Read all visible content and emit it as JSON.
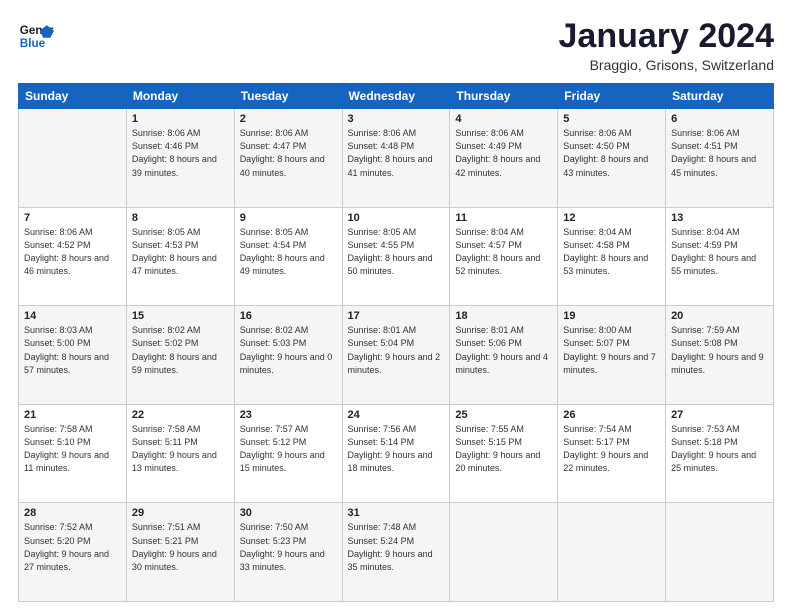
{
  "logo": {
    "line1": "General",
    "line2": "Blue"
  },
  "title": "January 2024",
  "location": "Braggio, Grisons, Switzerland",
  "days_header": [
    "Sunday",
    "Monday",
    "Tuesday",
    "Wednesday",
    "Thursday",
    "Friday",
    "Saturday"
  ],
  "weeks": [
    [
      {
        "day": "",
        "sunrise": "",
        "sunset": "",
        "daylight": ""
      },
      {
        "day": "1",
        "sunrise": "Sunrise: 8:06 AM",
        "sunset": "Sunset: 4:46 PM",
        "daylight": "Daylight: 8 hours and 39 minutes."
      },
      {
        "day": "2",
        "sunrise": "Sunrise: 8:06 AM",
        "sunset": "Sunset: 4:47 PM",
        "daylight": "Daylight: 8 hours and 40 minutes."
      },
      {
        "day": "3",
        "sunrise": "Sunrise: 8:06 AM",
        "sunset": "Sunset: 4:48 PM",
        "daylight": "Daylight: 8 hours and 41 minutes."
      },
      {
        "day": "4",
        "sunrise": "Sunrise: 8:06 AM",
        "sunset": "Sunset: 4:49 PM",
        "daylight": "Daylight: 8 hours and 42 minutes."
      },
      {
        "day": "5",
        "sunrise": "Sunrise: 8:06 AM",
        "sunset": "Sunset: 4:50 PM",
        "daylight": "Daylight: 8 hours and 43 minutes."
      },
      {
        "day": "6",
        "sunrise": "Sunrise: 8:06 AM",
        "sunset": "Sunset: 4:51 PM",
        "daylight": "Daylight: 8 hours and 45 minutes."
      }
    ],
    [
      {
        "day": "7",
        "sunrise": "Sunrise: 8:06 AM",
        "sunset": "Sunset: 4:52 PM",
        "daylight": "Daylight: 8 hours and 46 minutes."
      },
      {
        "day": "8",
        "sunrise": "Sunrise: 8:05 AM",
        "sunset": "Sunset: 4:53 PM",
        "daylight": "Daylight: 8 hours and 47 minutes."
      },
      {
        "day": "9",
        "sunrise": "Sunrise: 8:05 AM",
        "sunset": "Sunset: 4:54 PM",
        "daylight": "Daylight: 8 hours and 49 minutes."
      },
      {
        "day": "10",
        "sunrise": "Sunrise: 8:05 AM",
        "sunset": "Sunset: 4:55 PM",
        "daylight": "Daylight: 8 hours and 50 minutes."
      },
      {
        "day": "11",
        "sunrise": "Sunrise: 8:04 AM",
        "sunset": "Sunset: 4:57 PM",
        "daylight": "Daylight: 8 hours and 52 minutes."
      },
      {
        "day": "12",
        "sunrise": "Sunrise: 8:04 AM",
        "sunset": "Sunset: 4:58 PM",
        "daylight": "Daylight: 8 hours and 53 minutes."
      },
      {
        "day": "13",
        "sunrise": "Sunrise: 8:04 AM",
        "sunset": "Sunset: 4:59 PM",
        "daylight": "Daylight: 8 hours and 55 minutes."
      }
    ],
    [
      {
        "day": "14",
        "sunrise": "Sunrise: 8:03 AM",
        "sunset": "Sunset: 5:00 PM",
        "daylight": "Daylight: 8 hours and 57 minutes."
      },
      {
        "day": "15",
        "sunrise": "Sunrise: 8:02 AM",
        "sunset": "Sunset: 5:02 PM",
        "daylight": "Daylight: 8 hours and 59 minutes."
      },
      {
        "day": "16",
        "sunrise": "Sunrise: 8:02 AM",
        "sunset": "Sunset: 5:03 PM",
        "daylight": "Daylight: 9 hours and 0 minutes."
      },
      {
        "day": "17",
        "sunrise": "Sunrise: 8:01 AM",
        "sunset": "Sunset: 5:04 PM",
        "daylight": "Daylight: 9 hours and 2 minutes."
      },
      {
        "day": "18",
        "sunrise": "Sunrise: 8:01 AM",
        "sunset": "Sunset: 5:06 PM",
        "daylight": "Daylight: 9 hours and 4 minutes."
      },
      {
        "day": "19",
        "sunrise": "Sunrise: 8:00 AM",
        "sunset": "Sunset: 5:07 PM",
        "daylight": "Daylight: 9 hours and 7 minutes."
      },
      {
        "day": "20",
        "sunrise": "Sunrise: 7:59 AM",
        "sunset": "Sunset: 5:08 PM",
        "daylight": "Daylight: 9 hours and 9 minutes."
      }
    ],
    [
      {
        "day": "21",
        "sunrise": "Sunrise: 7:58 AM",
        "sunset": "Sunset: 5:10 PM",
        "daylight": "Daylight: 9 hours and 11 minutes."
      },
      {
        "day": "22",
        "sunrise": "Sunrise: 7:58 AM",
        "sunset": "Sunset: 5:11 PM",
        "daylight": "Daylight: 9 hours and 13 minutes."
      },
      {
        "day": "23",
        "sunrise": "Sunrise: 7:57 AM",
        "sunset": "Sunset: 5:12 PM",
        "daylight": "Daylight: 9 hours and 15 minutes."
      },
      {
        "day": "24",
        "sunrise": "Sunrise: 7:56 AM",
        "sunset": "Sunset: 5:14 PM",
        "daylight": "Daylight: 9 hours and 18 minutes."
      },
      {
        "day": "25",
        "sunrise": "Sunrise: 7:55 AM",
        "sunset": "Sunset: 5:15 PM",
        "daylight": "Daylight: 9 hours and 20 minutes."
      },
      {
        "day": "26",
        "sunrise": "Sunrise: 7:54 AM",
        "sunset": "Sunset: 5:17 PM",
        "daylight": "Daylight: 9 hours and 22 minutes."
      },
      {
        "day": "27",
        "sunrise": "Sunrise: 7:53 AM",
        "sunset": "Sunset: 5:18 PM",
        "daylight": "Daylight: 9 hours and 25 minutes."
      }
    ],
    [
      {
        "day": "28",
        "sunrise": "Sunrise: 7:52 AM",
        "sunset": "Sunset: 5:20 PM",
        "daylight": "Daylight: 9 hours and 27 minutes."
      },
      {
        "day": "29",
        "sunrise": "Sunrise: 7:51 AM",
        "sunset": "Sunset: 5:21 PM",
        "daylight": "Daylight: 9 hours and 30 minutes."
      },
      {
        "day": "30",
        "sunrise": "Sunrise: 7:50 AM",
        "sunset": "Sunset: 5:23 PM",
        "daylight": "Daylight: 9 hours and 33 minutes."
      },
      {
        "day": "31",
        "sunrise": "Sunrise: 7:48 AM",
        "sunset": "Sunset: 5:24 PM",
        "daylight": "Daylight: 9 hours and 35 minutes."
      },
      {
        "day": "",
        "sunrise": "",
        "sunset": "",
        "daylight": ""
      },
      {
        "day": "",
        "sunrise": "",
        "sunset": "",
        "daylight": ""
      },
      {
        "day": "",
        "sunrise": "",
        "sunset": "",
        "daylight": ""
      }
    ]
  ]
}
